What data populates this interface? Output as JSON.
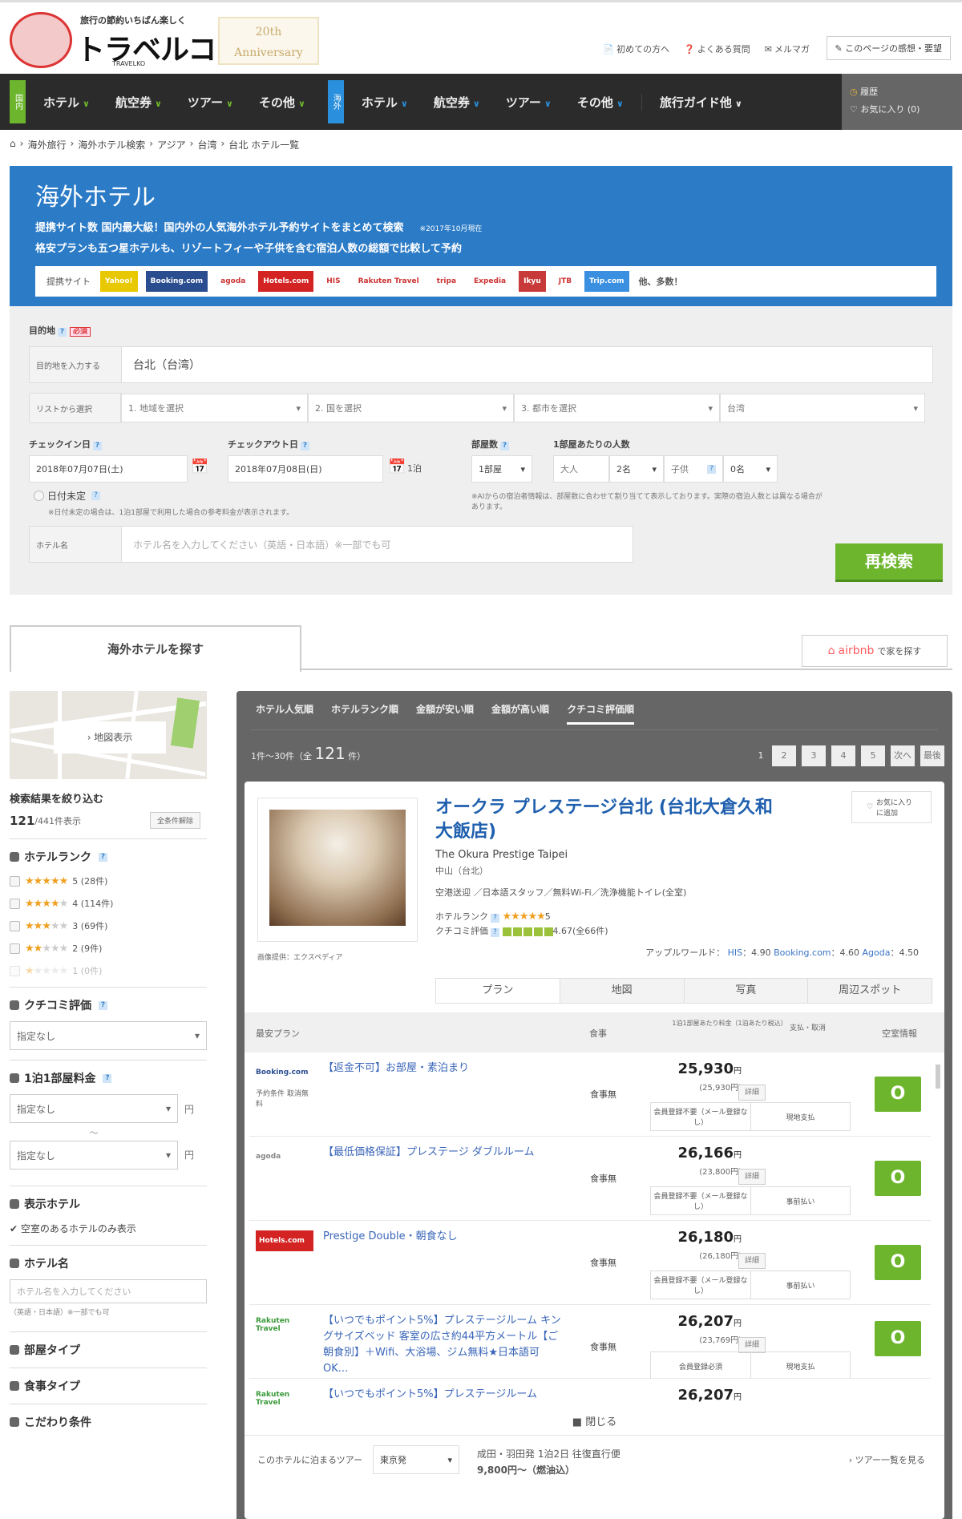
{
  "header": {
    "logo_tagline": "旅行の節約いちばん楽しく",
    "logo_name": "トラベルコ",
    "logo_sub": "TRAVELKO",
    "anniversary": "20th Anniversary",
    "links": [
      "初めての方へ",
      "よくある質問",
      "メルマガ"
    ],
    "feedback": "このページの感想・要望"
  },
  "nav": {
    "domestic_tag": "国内",
    "domestic_items": [
      "ホテル",
      "航空券",
      "ツアー",
      "その他"
    ],
    "overseas_tag": "海外",
    "overseas_items": [
      "ホテル",
      "航空券",
      "ツアー",
      "その他"
    ],
    "guide": "旅行ガイド他",
    "history": "履歴",
    "favorites": "お気に入り (0)"
  },
  "breadcrumb": [
    "海外旅行",
    "海外ホテル検索",
    "アジア",
    "台湾",
    "台北 ホテル一覧"
  ],
  "banner": {
    "title": "海外ホテル",
    "line1": "提携サイト数 国内最大級！国内外の人気海外ホテル予約サイトをまとめて検索",
    "line1_note": "※2017年10月現在",
    "line2": "格安プランも五つ星ホテルも、リゾートフィーや子供を含む宿泊人数の総額で比較して予約",
    "sites_label": "提携サイト",
    "sites": [
      {
        "name": "Yahoo!",
        "color": "#e8c800"
      },
      {
        "name": "Booking.com",
        "color": "#2a4d8f"
      },
      {
        "name": "agoda",
        "color": "#ffffff"
      },
      {
        "name": "Hotels.com",
        "color": "#d32323"
      },
      {
        "name": "HIS",
        "color": "#ffffff"
      },
      {
        "name": "Rakuten Travel",
        "color": "#ffffff"
      },
      {
        "name": "tripa",
        "color": "#ffffff"
      },
      {
        "name": "Expedia",
        "color": "#ffffff"
      },
      {
        "name": "Ikyu",
        "color": "#c83a3a"
      },
      {
        "name": "JTB",
        "color": "#ffffff"
      },
      {
        "name": "Trip.com",
        "color": "#3a8fe0"
      }
    ],
    "sites_more": "他、多数！"
  },
  "search": {
    "destination_label": "目的地",
    "required": "必須",
    "destination_side": "目的地を入力する",
    "destination_value": "台北（台湾）",
    "list_side": "リストから選択",
    "list_selects": [
      "1. 地域を選択",
      "2. 国を選択",
      "3. 都市を選択",
      "台湾"
    ],
    "checkin_label": "チェックイン日",
    "checkin_value": "2018年07月07日(土)",
    "checkout_label": "チェックアウト日",
    "checkout_value": "2018年07月08日(日)",
    "nights": "1泊",
    "undecided": "日付未定",
    "undecided_note": "※日付未定の場合は、1泊1部屋で利用した場合の参考料金が表示されます。",
    "rooms_label": "部屋数",
    "rooms_value": "1部屋",
    "guests_label": "1部屋あたりの人数",
    "adults_label": "大人",
    "adults_value": "2名",
    "children_label": "子供",
    "children_value": "0名",
    "guests_note": "※AIからの宿泊者情報は、部屋数に合わせて割り当てて表示しております。実際の宿泊人数とは異なる場合があります。",
    "hotel_side": "ホテル名",
    "hotel_placeholder": "ホテル名を入力してください（英語・日本語）※一部でも可",
    "research_button": "再検索"
  },
  "tabs": {
    "active": "海外ホテルを探す",
    "airbnb": "airbnb",
    "airbnb_suffix": "で家を探す"
  },
  "sidebar": {
    "map_button": "› 地図表示",
    "filter_title": "検索結果を絞り込む",
    "count": "121",
    "count_total": "/441件表示",
    "clear": "全条件解除",
    "rank_title": "ホテルランク",
    "ranks": [
      {
        "stars": 5,
        "label": "5 (28件)"
      },
      {
        "stars": 4,
        "label": "4 (114件)"
      },
      {
        "stars": 3,
        "label": "3 (69件)"
      },
      {
        "stars": 2,
        "label": "2 (9件)"
      },
      {
        "stars": 1,
        "label": "1 (0件)"
      }
    ],
    "review_title": "クチコミ評価",
    "review_value": "指定なし",
    "price_title": "1泊1部屋料金",
    "price_min": "指定なし",
    "price_max": "指定なし",
    "price_sep": "〜",
    "yen": "円",
    "show_title": "表示ホテル",
    "show_vacant": "空室のあるホテルのみ表示",
    "name_title": "ホテル名",
    "name_placeholder": "ホテル名を入力してください",
    "name_note": "（英語・日本語）※一部でも可",
    "room_type": "部屋タイプ",
    "meal_type": "食事タイプ",
    "special": "こだわり条件"
  },
  "results": {
    "sort_tabs": [
      "ホテル人気順",
      "ホテルランク順",
      "金額が安い順",
      "金額が高い順",
      "クチコミ評価順"
    ],
    "active_sort": 4,
    "range": "1件〜30件（全",
    "total": "121",
    "range_end": "件）",
    "pages": [
      "1",
      "2",
      "3",
      "4",
      "5",
      "次へ",
      "最後"
    ]
  },
  "hotel": {
    "name": "オークラ プレステージ台北 (台北大倉久和大飯店)",
    "name_en": "The Okura Prestige Taipei",
    "area": "中山（台北）",
    "features": "空港送迎 ／日本語スタッフ／無料Wi-Fi／洗浄機能トイレ(全室)",
    "photo_credit": "画像提供：エクスペディア",
    "favorite": "お気に入りに追加",
    "rank_label": "ホテルランク",
    "rank_value": 5,
    "review_label": "クチコミ評価",
    "review_score": 4.67,
    "review_text": "4.67(全66件)",
    "external_label": "アップルワールド：",
    "external": [
      {
        "site": "HIS",
        "score": "4.90"
      },
      {
        "site": "Booking.com",
        "score": "4.60"
      },
      {
        "site": "Agoda",
        "score": "4.50"
      }
    ],
    "content_tabs": [
      "プラン",
      "地図",
      "写真",
      "周辺スポット"
    ],
    "plan_header": {
      "plan": "最安プラン",
      "meal": "食事",
      "price": "1泊1部屋あたり料金（1泊あたり税込）",
      "conditions": "支払・取消",
      "site": "空室情報"
    },
    "plans": [
      {
        "provider": "Booking.com",
        "provider_color": "#2a4d8f",
        "provider_note": "予約条件 取消無料",
        "name": "【返金不可】お部屋・素泊まり",
        "meal": "食事無",
        "price": "25,930",
        "yen": "円",
        "sub": "(25,930円)",
        "detail": "詳細",
        "cond1": "会員登録不要（メール登録なし）",
        "cond2": "現地支払",
        "go": "O"
      },
      {
        "provider": "agoda",
        "provider_color": "#888888",
        "provider_note": "",
        "name": "【最低価格保証】プレステージ ダブルルーム",
        "meal": "食事無",
        "price": "26,166",
        "yen": "円",
        "sub": "(23,800円)",
        "detail": "詳細",
        "cond1": "会員登録不要（メール登録なし）",
        "cond2": "事前払い",
        "go": "O"
      },
      {
        "provider": "Hotels.com",
        "provider_color": "#d32323",
        "provider_note": "",
        "name": "Prestige Double・朝食なし",
        "meal": "食事無",
        "price": "26,180",
        "yen": "円",
        "sub": "(26,180円)",
        "detail": "詳細",
        "cond1": "会員登録不要（メール登録なし）",
        "cond2": "事前払い",
        "go": "O"
      },
      {
        "provider": "Rakuten Travel",
        "provider_color": "#3a9a3a",
        "provider_note": "",
        "name": "【いつでもポイント5%】プレステージルーム キングサイズベッド 客室の広さ約44平方メートル【ご朝食別】＋Wifi、大浴場、ジム無料★日本語可OK...",
        "meal": "食事無",
        "price": "26,207",
        "yen": "円",
        "sub": "(23,769円)",
        "detail": "詳細",
        "cond1": "会員登録必須",
        "cond2": "現地支払",
        "go": "O"
      },
      {
        "provider": "Rakuten Travel",
        "provider_color": "#3a9a3a",
        "provider_note": "",
        "name": "【いつでもポイント5%】プレステージルーム",
        "meal": "",
        "price": "26,207",
        "yen": "円",
        "sub": "",
        "detail": "",
        "cond1": "",
        "cond2": "",
        "go": ""
      }
    ],
    "close": "閉じる",
    "tour_label": "このホテルに泊まるツアー",
    "tour_select": "東京発",
    "tour_line1": "成田・羽田発 1泊2日 往復直行便",
    "tour_line2": "9,800円〜（燃油込）",
    "tour_link": "› ツアー一覧を見る"
  }
}
